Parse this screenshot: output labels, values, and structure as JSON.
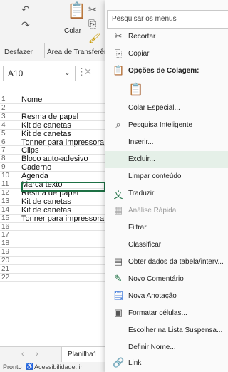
{
  "ribbon": {
    "undo_label": "Desfazer",
    "clipboard_label": "Área de Transferên...",
    "paste_label": "Colar"
  },
  "formula_bar": {
    "cell_ref": "A10"
  },
  "sheet": {
    "rows": [
      {
        "n": "1",
        "a": "Nome"
      },
      {
        "n": "2",
        "a": ""
      },
      {
        "n": "3",
        "a": "Resma de papel"
      },
      {
        "n": "4",
        "a": "Kit de canetas"
      },
      {
        "n": "5",
        "a": "Kit de canetas"
      },
      {
        "n": "6",
        "a": "Tonner para impressora"
      },
      {
        "n": "7",
        "a": "Clips"
      },
      {
        "n": "8",
        "a": "Bloco auto-adesivo"
      },
      {
        "n": "9",
        "a": "Caderno"
      },
      {
        "n": "10",
        "a": "Agenda"
      },
      {
        "n": "11",
        "a": "Marca texto"
      },
      {
        "n": "12",
        "a": "Resma de papel"
      },
      {
        "n": "13",
        "a": "Kit de canetas"
      },
      {
        "n": "14",
        "a": "Kit de canetas"
      },
      {
        "n": "15",
        "a": "Tonner para impressora"
      },
      {
        "n": "16",
        "a": ""
      },
      {
        "n": "17",
        "a": ""
      },
      {
        "n": "18",
        "a": ""
      },
      {
        "n": "19",
        "a": ""
      },
      {
        "n": "20",
        "a": ""
      },
      {
        "n": "21",
        "a": ""
      },
      {
        "n": "22",
        "a": ""
      }
    ],
    "sheet_tab": "Planilha1",
    "status_ready": "Pronto",
    "status_accessibility": "Acessibilidade: in"
  },
  "context_menu": {
    "search_placeholder": "Pesquisar os menus",
    "items": {
      "cut": "Recortar",
      "copy": "Copiar",
      "paste_options": "Opções de Colagem:",
      "paste_special": "Colar Especial...",
      "smart_lookup": "Pesquisa Inteligente",
      "insert": "Inserir...",
      "delete": "Excluir...",
      "clear": "Limpar conteúdo",
      "translate": "Traduzir",
      "quick_analysis": "Análise Rápida",
      "filter": "Filtrar",
      "sort": "Classificar",
      "get_data": "Obter dados da tabela/interv...",
      "new_comment": "Novo Comentário",
      "new_note": "Nova Anotação",
      "format_cells": "Formatar células...",
      "pick_list": "Escolher na Lista Suspensa...",
      "define_name": "Definir Nome...",
      "link": "Link"
    }
  },
  "colors": {
    "highlight": "#e5f0e8",
    "selected_border": "#1e7145",
    "icon_green": "#1e7145"
  }
}
